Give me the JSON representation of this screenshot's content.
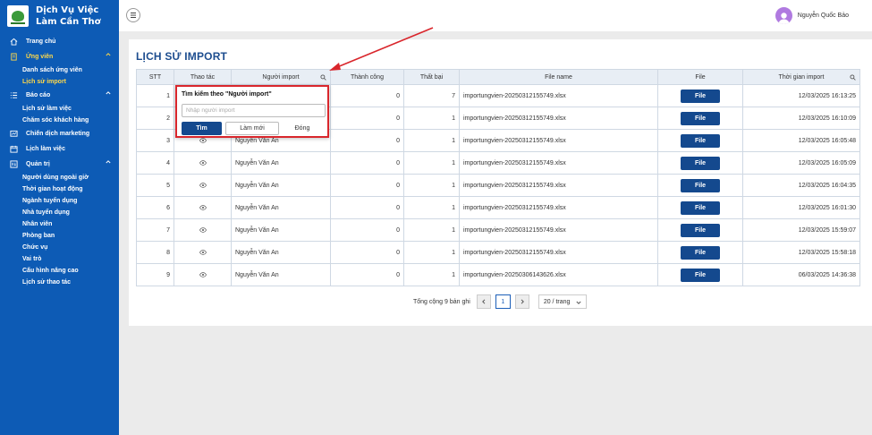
{
  "brand": {
    "title": "Dịch Vụ Việc Làm Cần Thơ"
  },
  "header": {
    "user_name": "Nguyễn Quốc Bảo"
  },
  "sidebar": {
    "items": [
      {
        "label": "Trang chủ",
        "icon": "home-icon",
        "level": "top"
      },
      {
        "label": "Ứng viên",
        "icon": "document-icon",
        "level": "top",
        "active": true,
        "expanded": true
      },
      {
        "label": "Danh sách ứng viên",
        "level": "sub"
      },
      {
        "label": "Lịch sử import",
        "level": "sub",
        "active": true
      },
      {
        "label": "Báo cáo",
        "icon": "list-icon",
        "level": "top",
        "expanded": true
      },
      {
        "label": "Lịch sử làm việc",
        "level": "sub"
      },
      {
        "label": "Chăm sóc khách hàng",
        "level": "sub"
      },
      {
        "label": "Chiến dịch marketing",
        "icon": "campaign-icon",
        "level": "top"
      },
      {
        "label": "Lịch làm việc",
        "icon": "calendar-icon",
        "level": "top"
      },
      {
        "label": "Quản trị",
        "icon": "admin-icon",
        "level": "top",
        "expanded": true
      },
      {
        "label": "Người dùng ngoài giờ",
        "level": "sub"
      },
      {
        "label": "Thời gian hoạt động",
        "level": "sub"
      },
      {
        "label": "Ngành tuyển dụng",
        "level": "sub"
      },
      {
        "label": "Nhà tuyển dụng",
        "level": "sub"
      },
      {
        "label": "Nhân viên",
        "level": "sub"
      },
      {
        "label": "Phòng ban",
        "level": "sub"
      },
      {
        "label": "Chức vụ",
        "level": "sub"
      },
      {
        "label": "Vai trò",
        "level": "sub"
      },
      {
        "label": "Cấu hình nâng cao",
        "level": "sub"
      },
      {
        "label": "Lịch sử thao tác",
        "level": "sub"
      }
    ]
  },
  "page": {
    "title": "LỊCH SỬ IMPORT"
  },
  "table": {
    "columns": [
      "STT",
      "Thao tác",
      "Người import",
      "Thành công",
      "Thất bại",
      "File name",
      "File",
      "Thời gian import"
    ],
    "file_button_label": "File",
    "rows": [
      {
        "stt": "1",
        "importer": "",
        "success": "0",
        "failed": "7",
        "file_name": "importungvien-20250312155749.xlsx",
        "time": "12/03/2025 16:13:25"
      },
      {
        "stt": "2",
        "importer": "",
        "success": "0",
        "failed": "1",
        "file_name": "importungvien-20250312155749.xlsx",
        "time": "12/03/2025 16:10:09"
      },
      {
        "stt": "3",
        "importer": "Nguyễn Văn An",
        "success": "0",
        "failed": "1",
        "file_name": "importungvien-20250312155749.xlsx",
        "time": "12/03/2025 16:05:48"
      },
      {
        "stt": "4",
        "importer": "Nguyễn Văn An",
        "success": "0",
        "failed": "1",
        "file_name": "importungvien-20250312155749.xlsx",
        "time": "12/03/2025 16:05:09"
      },
      {
        "stt": "5",
        "importer": "Nguyễn Văn An",
        "success": "0",
        "failed": "1",
        "file_name": "importungvien-20250312155749.xlsx",
        "time": "12/03/2025 16:04:35"
      },
      {
        "stt": "6",
        "importer": "Nguyễn Văn An",
        "success": "0",
        "failed": "1",
        "file_name": "importungvien-20250312155749.xlsx",
        "time": "12/03/2025 16:01:30"
      },
      {
        "stt": "7",
        "importer": "Nguyễn Văn An",
        "success": "0",
        "failed": "1",
        "file_name": "importungvien-20250312155749.xlsx",
        "time": "12/03/2025 15:59:07"
      },
      {
        "stt": "8",
        "importer": "Nguyễn Văn An",
        "success": "0",
        "failed": "1",
        "file_name": "importungvien-20250312155749.xlsx",
        "time": "12/03/2025 15:58:18"
      },
      {
        "stt": "9",
        "importer": "Nguyễn Văn An",
        "success": "0",
        "failed": "1",
        "file_name": "importungvien-20250306143626.xlsx",
        "time": "06/03/2025 14:36:38"
      }
    ]
  },
  "pagination": {
    "total_text": "Tổng cộng 9 bản ghi",
    "current_page": "1",
    "page_size": "20 / trang"
  },
  "filter_popover": {
    "title": "Tìm kiếm theo \"Người import\"",
    "placeholder": "Nhập người import",
    "value": "",
    "search_label": "Tìm",
    "reset_label": "Làm mới",
    "close_label": "Đóng"
  },
  "colors": {
    "sidebar_bg": "#0d5bb5",
    "accent": "#14498e",
    "active_nav": "#ffd94a",
    "highlight": "#d9262c"
  }
}
